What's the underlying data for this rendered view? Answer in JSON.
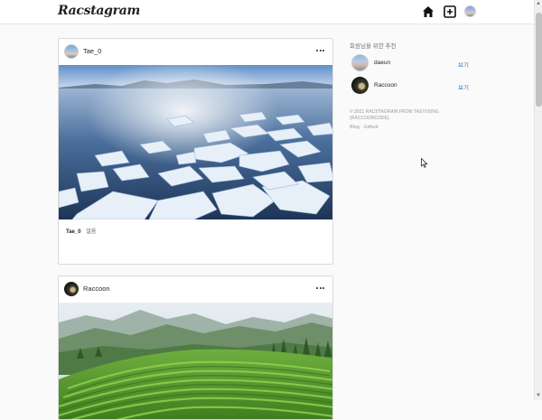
{
  "app": {
    "title": "Racstagram"
  },
  "nav": {
    "icons": [
      "home-icon",
      "add-post-icon",
      "profile-avatar"
    ]
  },
  "feed": {
    "posts": [
      {
        "username": "Tae_0",
        "image": "frozen-lake-broken-ice",
        "caption_user": "Tae_0",
        "caption_text": "얼음"
      },
      {
        "username": "Raccoon",
        "image": "green-tea-plantation-hills"
      }
    ]
  },
  "sidebar": {
    "title": "회원님을 위한 추천",
    "suggestions": [
      {
        "username": "daeun",
        "action": "보기"
      },
      {
        "username": "Raccoon",
        "action": "보기"
      }
    ],
    "copyright": "© 2021 Racstagram from Taeyoung (Raccooncode)",
    "links": [
      "Blog",
      "Github"
    ],
    "link_separator": "·"
  },
  "colors": {
    "background": "#fafafa",
    "card": "#ffffff",
    "border": "#dbdbdb",
    "link": "#3a78d8",
    "muted": "#b5b5b5"
  }
}
